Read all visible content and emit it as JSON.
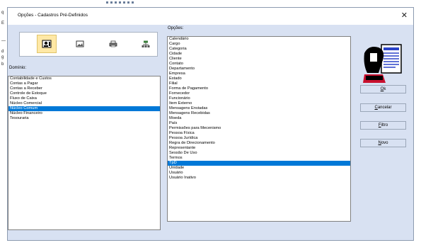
{
  "window": {
    "title": "Opções - Cadastros Pré-Definidos",
    "close_symbol": "✕"
  },
  "background": {
    "left_chars": [
      "q",
      "E",
      "—",
      "d",
      "g",
      "b"
    ]
  },
  "toolbar": {
    "icons": [
      "contact-card-icon",
      "image-icon",
      "printer-icon",
      "network-icon"
    ],
    "active_index": 0
  },
  "dominio": {
    "label": "Domínio:",
    "items": [
      "Contabilidade e Custos",
      "Contas a Pagar",
      "Contas a Receber",
      "Controle de Estoque",
      "Fluxo de Caixa",
      "Núcleo Comercial",
      "Núcleo Comum",
      "Núcleo Financeiro",
      "Tesouraria"
    ],
    "selected_index": 6
  },
  "opcoes": {
    "label": "Opções:",
    "items": [
      "Calendário",
      "Cargo",
      "Categoria",
      "Cidade",
      "Cliente",
      "Contato",
      "Departamento",
      "Empresa",
      "Estado",
      "Filial",
      "Forma de Pagamento",
      "Fornecedor",
      "Funcionário",
      "Item Externo",
      "Mensagens Enviadas",
      "Mensagens Recebidas",
      "Moeda",
      "País",
      "Permissões para Mecenismo",
      "Pessoa Física",
      "Pessoa Jurídica",
      "Regra de Direcionamento",
      "Representante",
      "Sessão De Uso",
      "Termos",
      "TpD",
      "Unidade",
      "Usuário",
      "Usuário Inativo"
    ],
    "selected_index": 25
  },
  "buttons": {
    "ok": {
      "first": "O",
      "rest": "k"
    },
    "cancel": {
      "first": "C",
      "rest": "ancelar"
    },
    "filter": {
      "first": "F",
      "rest": "iltro"
    },
    "new": {
      "first": "N",
      "rest": "ovo"
    }
  },
  "colors": {
    "selection": "#0078d7",
    "dialog_bg": "#d8e1f2",
    "active_tool": "#ffe8a6"
  }
}
